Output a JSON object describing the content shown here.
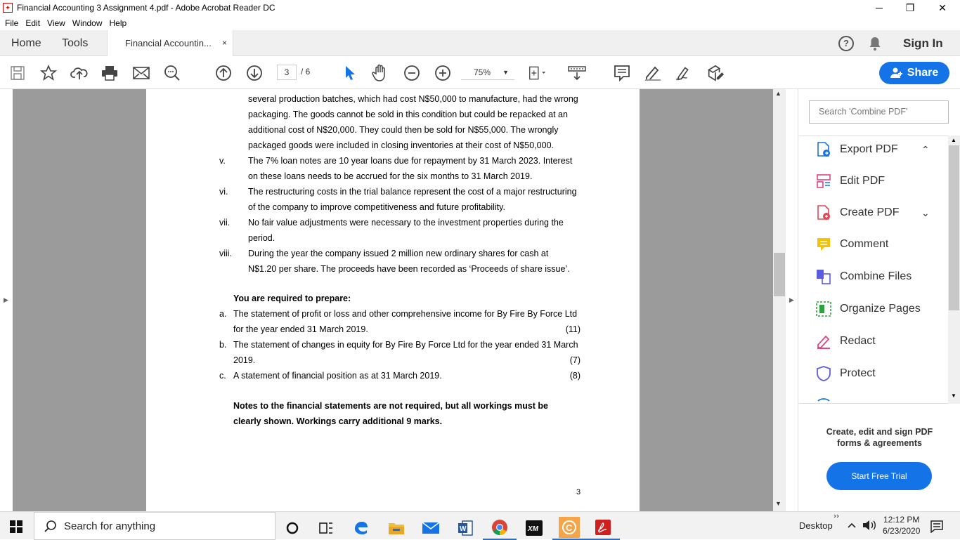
{
  "window": {
    "title": "Financial Accounting 3 Assignment 4.pdf - Adobe Acrobat Reader DC",
    "controls": {
      "minimize": "─",
      "restore": "❐",
      "close": "✕"
    }
  },
  "menu": [
    "File",
    "Edit",
    "View",
    "Window",
    "Help"
  ],
  "tabs": {
    "home": "Home",
    "tools": "Tools",
    "document": "Financial Accountin...",
    "close": "×"
  },
  "header": {
    "help": "?",
    "sign_in": "Sign In"
  },
  "toolbar": {
    "current_page": "3",
    "total_pages": "/ 6",
    "zoom": "75%",
    "share_label": "Share",
    "icons": [
      "save-icon",
      "bookmark-star-icon",
      "upload-icon",
      "print-icon",
      "email-icon",
      "search-icon",
      "page-up-icon",
      "page-down-icon",
      "select-cursor-icon",
      "hand-icon",
      "zoom-out-icon",
      "zoom-in-icon",
      "fit-page-icon",
      "scroll-mode-icon",
      "comment-icon",
      "highlight-icon",
      "sign-icon",
      "fill-sign-icon"
    ]
  },
  "document": {
    "lines": [
      {
        "text": "several production batches, which had cost N$50,000 to manufacture, had the wrong",
        "indent": "t"
      },
      {
        "text": "packaging. The goods  cannot be sold in this condition but could be repacked at an",
        "indent": "t"
      },
      {
        "text": "additional cost  of N$20,000. They  could then be sold for N$55,000. The wrongly",
        "indent": "t"
      },
      {
        "text": "packaged goods were included in closing inventories at their cost of N$50,000.",
        "indent": "t"
      },
      {
        "num": "v.",
        "text": "The 7% loan notes are 10 year loans due for repayment  by 31 March 2023. Interest",
        "indent": "t"
      },
      {
        "text": "on these loans needs to be accrued for the six months to 31 March 2019.",
        "indent": "t"
      },
      {
        "num": "vi.",
        "text": "The restructuring costs in the trial balance represent the cost of a major restructuring",
        "indent": "t"
      },
      {
        "text": "of the company to improve competitiveness and future profitability.",
        "indent": "t"
      },
      {
        "num": "vii.",
        "text": "No fair value adjustments were necessary to the investment properties during the",
        "indent": "t"
      },
      {
        "text": "period.",
        "indent": "t"
      },
      {
        "num": "viii.",
        "text": "During the year the company issued 2 million new ordinary shares for cash at",
        "indent": "t"
      },
      {
        "text": "N$1.20 per share. The proceeds have been recorded as ‘Proceeds of share issue’.",
        "indent": "t"
      }
    ],
    "required_heading": "You are required to prepare:",
    "requirements": [
      {
        "letter": "a.",
        "line1": "The statement of profit or loss and other comprehensive income for By Fire By Force Ltd",
        "line2": "for the year ended 31 March 2019.",
        "marks": "(11)"
      },
      {
        "letter": "b.",
        "line1": "The statement of changes in equity for By Fire By Force Ltd for the year ended 31 March",
        "line2": "2019.",
        "marks": "(7)"
      },
      {
        "letter": "c.",
        "line1": "A statement of financial position as at 31 March 2019.",
        "line2": "",
        "marks": "(8)"
      }
    ],
    "notes_line1": "Notes to the financial statements are not required, but all workings must be",
    "notes_line2": "clearly shown.  Workings carry additional 9 marks.",
    "page_number": "3"
  },
  "panel": {
    "search_placeholder": "Search 'Combine PDF'",
    "tools": [
      {
        "label": "Export PDF",
        "icon": "export-pdf-icon",
        "color": "#1473e6"
      },
      {
        "label": "Edit PDF",
        "icon": "edit-pdf-icon",
        "color": "#e04580"
      },
      {
        "label": "Create PDF",
        "icon": "create-pdf-icon",
        "color": "#e34850"
      },
      {
        "label": "Comment",
        "icon": "comment-tool-icon",
        "color": "#f5c400"
      },
      {
        "label": "Combine Files",
        "icon": "combine-files-icon",
        "color": "#5c5ce0"
      },
      {
        "label": "Organize Pages",
        "icon": "organize-pages-icon",
        "color": "#2da140"
      },
      {
        "label": "Redact",
        "icon": "redact-icon",
        "color": "#e04580"
      },
      {
        "label": "Protect",
        "icon": "protect-icon",
        "color": "#5c5ce0"
      }
    ],
    "promo_line1": "Create, edit and sign PDF",
    "promo_line2": "forms & agreements",
    "trial_button": "Start Free Trial"
  },
  "taskbar": {
    "search_placeholder": "Search for anything",
    "desktop_label": "Desktop",
    "time": "12:12 PM",
    "date": "6/23/2020"
  },
  "colors": {
    "accent": "#1473e6",
    "viewer_bg": "#9b9b9b",
    "acrobat_red": "#d11f1f"
  }
}
